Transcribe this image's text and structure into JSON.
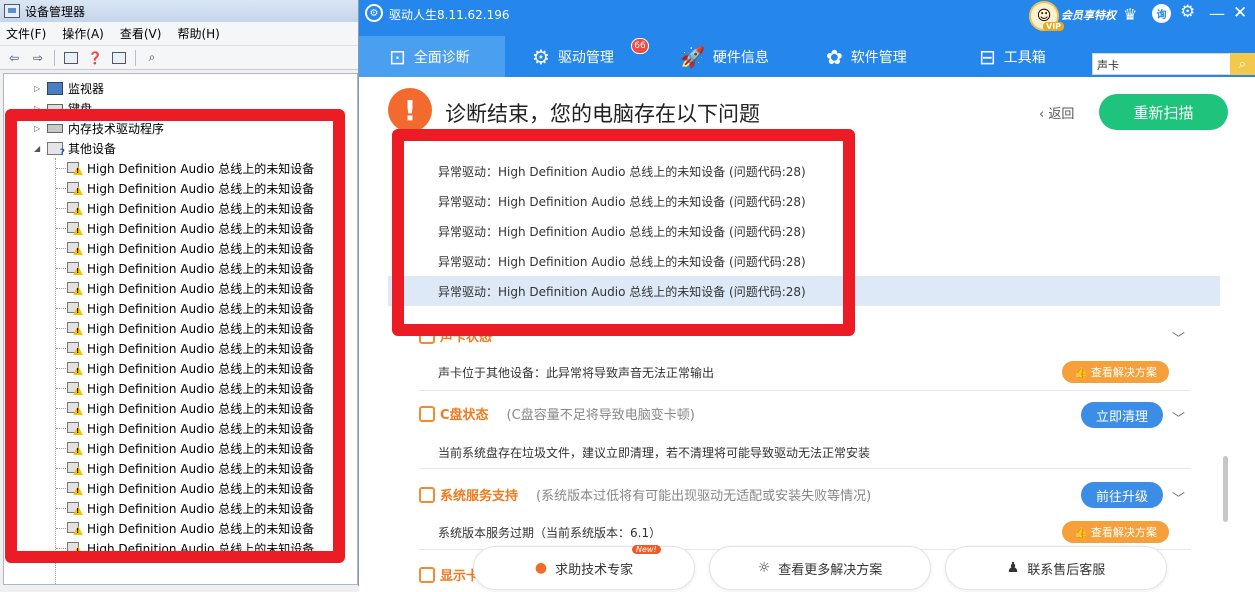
{
  "device_manager": {
    "title": "设备管理器",
    "menu": [
      "文件(F)",
      "操作(A)",
      "查看(V)",
      "帮助(H)"
    ],
    "categories": {
      "monitor": "监视器",
      "keyboard": "键盘",
      "memory": "内存技术驱动程序",
      "other": "其他设备"
    },
    "device_label": "High Definition Audio 总线上的未知设备",
    "device_count": 20
  },
  "app": {
    "title": "驱动人生8.11.62.196",
    "vip_text": "会员享特权",
    "vip_badge": "VIP",
    "consult_label": "询",
    "tabs": [
      {
        "label": "全面诊断",
        "icon": "monitor-pulse-icon"
      },
      {
        "label": "驱动管理",
        "icon": "gear-icon"
      },
      {
        "label": "硬件信息",
        "icon": "rocket-icon"
      },
      {
        "label": "软件管理",
        "icon": "flower-icon"
      },
      {
        "label": "工具箱",
        "icon": "toolbox-icon"
      }
    ],
    "driver_badge": "66",
    "search_value": "声卡",
    "diag_title": "诊断结束，您的电脑存在以下问题",
    "back_label": "返回",
    "rescan_label": "重新扫描",
    "issues": [
      "异常驱动：High Definition Audio 总线上的未知设备 (问题代码:28)",
      "异常驱动：High Definition Audio 总线上的未知设备 (问题代码:28)",
      "异常驱动：High Definition Audio 总线上的未知设备 (问题代码:28)",
      "异常驱动：High Definition Audio 总线上的未知设备 (问题代码:28)",
      "异常驱动：High Definition Audio 总线上的未知设备 (问题代码:28)"
    ],
    "sections": {
      "sound": {
        "partial_text": "声卡状态",
        "detail": "声卡位于其他设备：此异常将导致声音无法正常输出",
        "solution": "查看解决方案"
      },
      "cdrive": {
        "title": "C盘状态",
        "desc": "(C盘容量不足将导致电脑变卡顿)",
        "button": "立即清理",
        "detail": "当前系统盘存在垃圾文件，建议立即清理，若不清理将可能导致驱动无法正常安装"
      },
      "service": {
        "title": "系统服务支持",
        "desc": "(系统版本过低将有可能出现驱动无适配或安装失败等情况)",
        "button": "前往升级",
        "detail": "系统版本服务过期（当前系统版本：6.1）",
        "solution": "查看解决方案"
      },
      "display": {
        "title": "显示卡"
      }
    },
    "bottom": {
      "expert": "求助技术专家",
      "new_badge": "New!",
      "more": "查看更多解决方案",
      "service": "联系售后客服"
    }
  }
}
